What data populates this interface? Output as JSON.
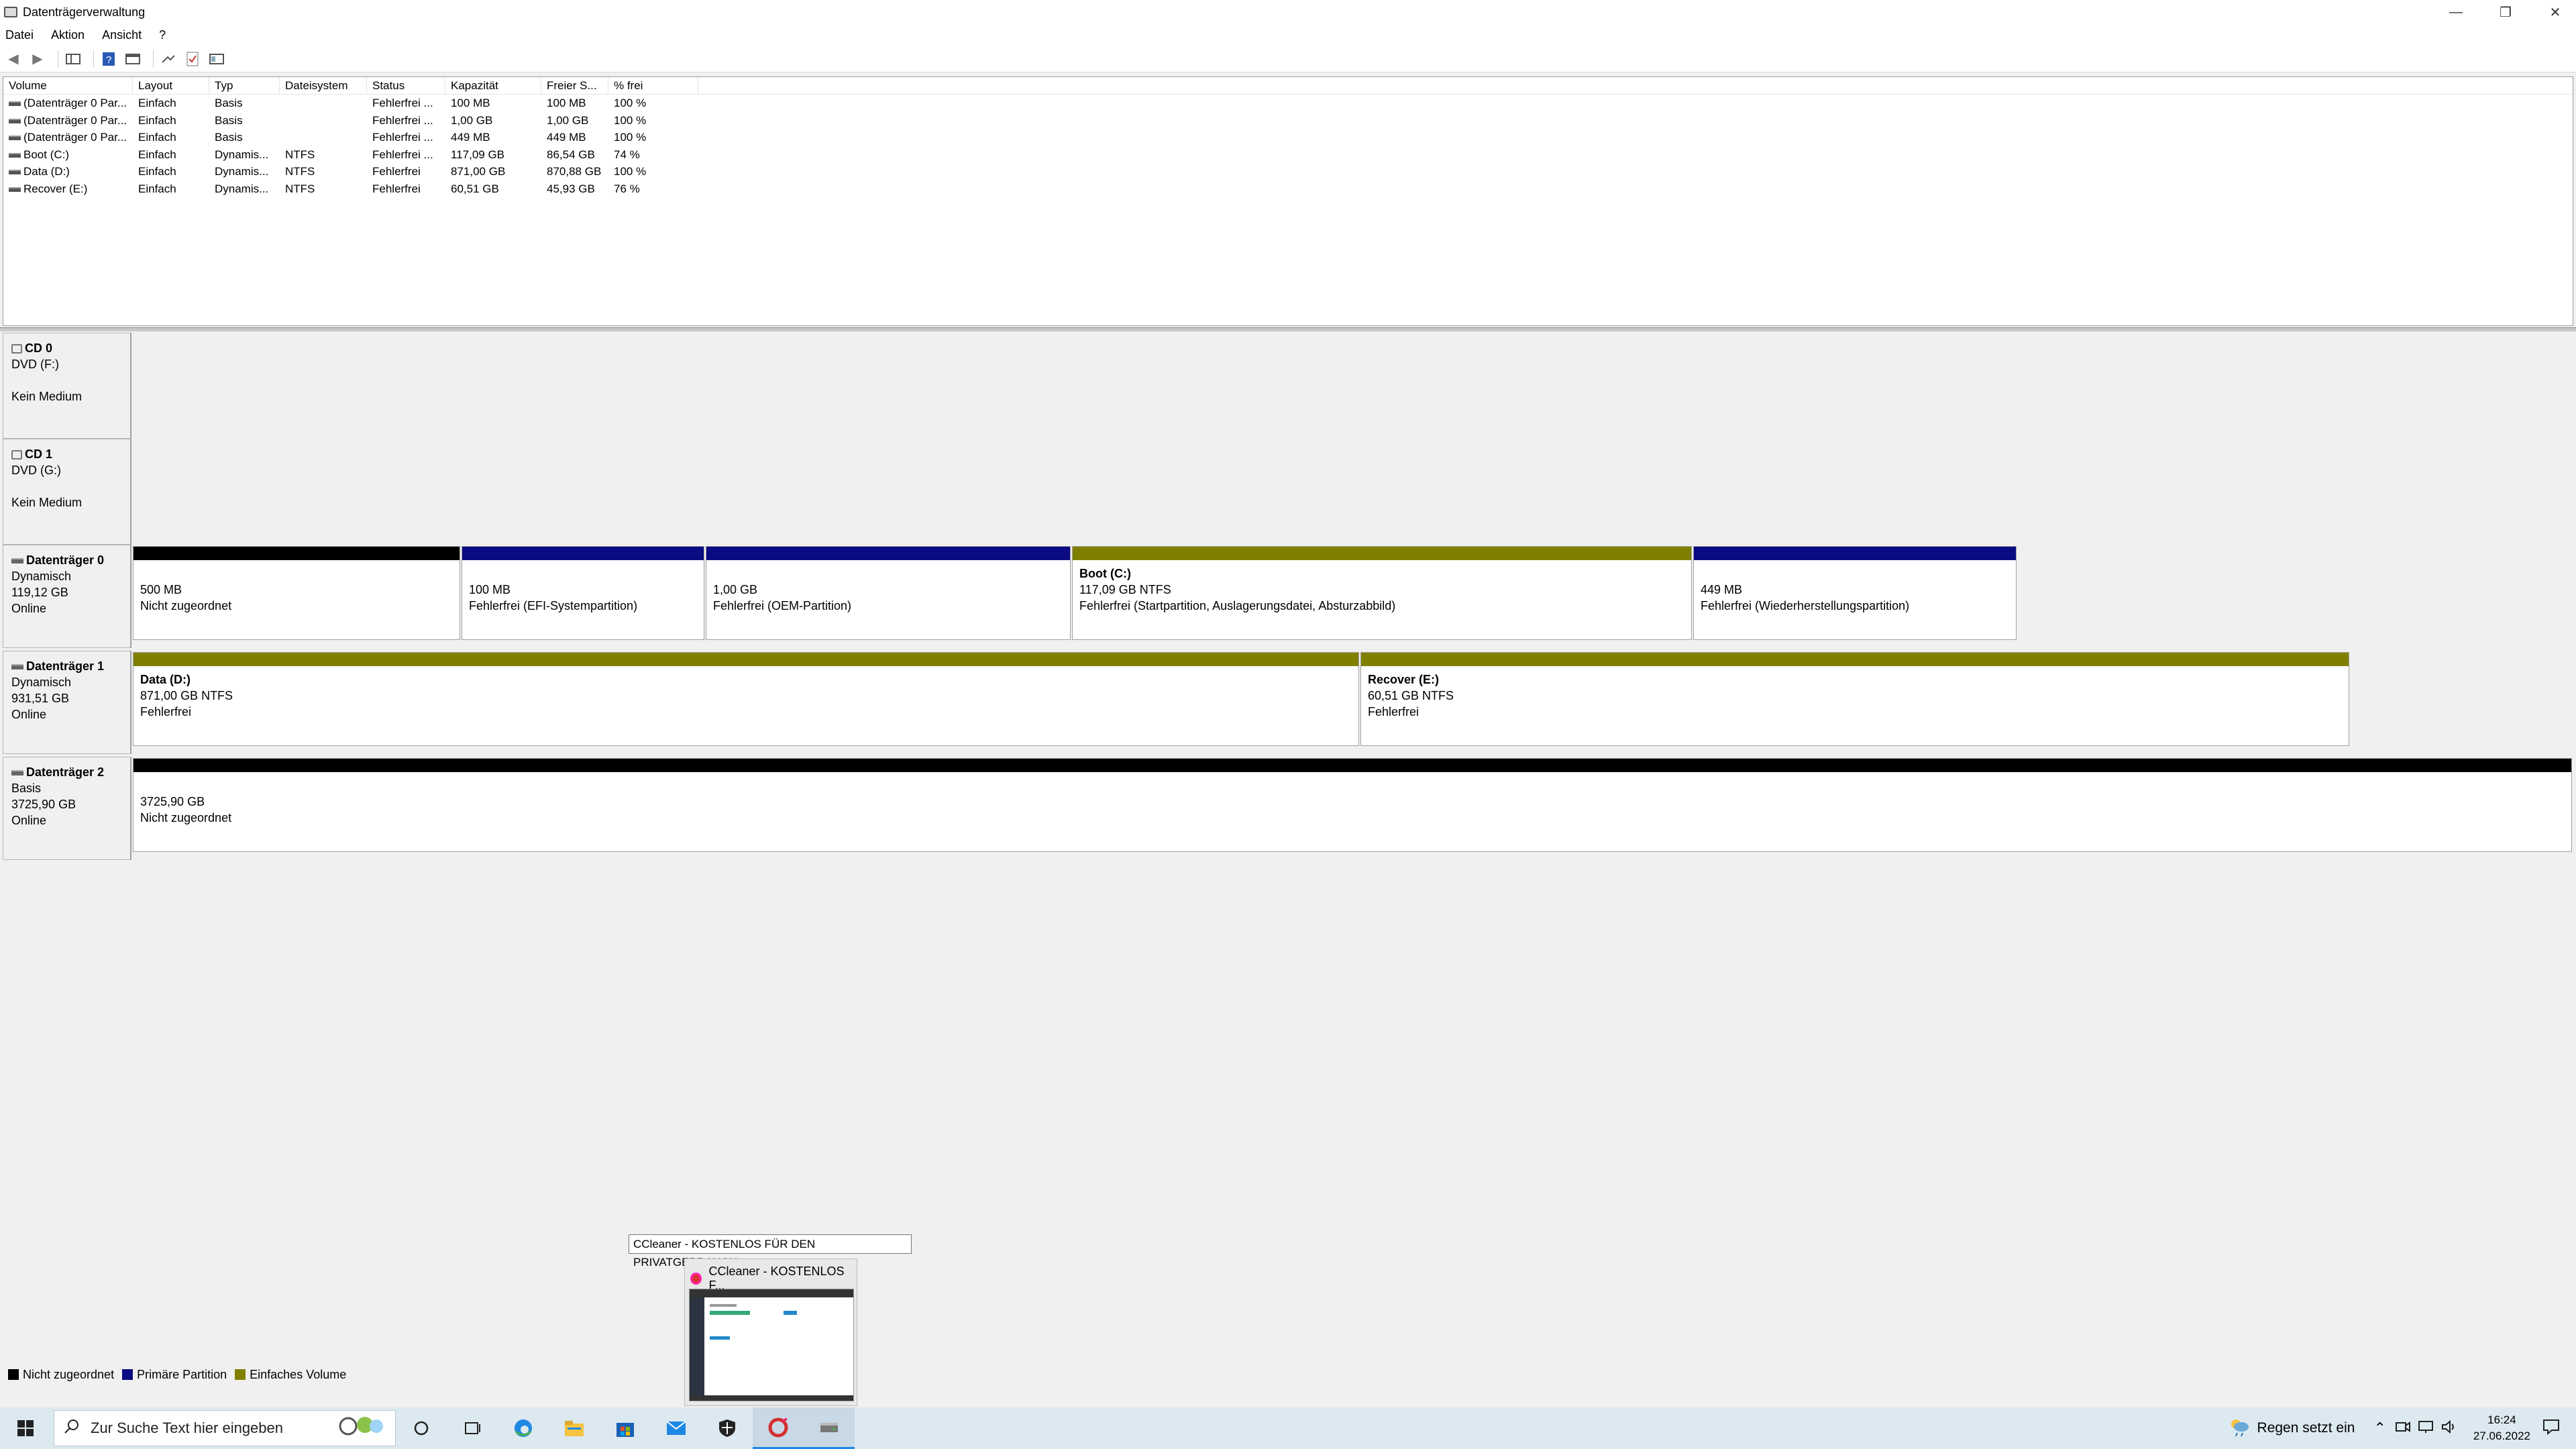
{
  "window": {
    "title": "Datenträgerverwaltung"
  },
  "menu": [
    "Datei",
    "Aktion",
    "Ansicht",
    "?"
  ],
  "volumes": {
    "columns": [
      "Volume",
      "Layout",
      "Typ",
      "Dateisystem",
      "Status",
      "Kapazität",
      "Freier S...",
      "% frei"
    ],
    "rows": [
      [
        "(Datenträger 0 Par...",
        "Einfach",
        "Basis",
        "",
        "Fehlerfrei ...",
        "100 MB",
        "100 MB",
        "100 %"
      ],
      [
        "(Datenträger 0 Par...",
        "Einfach",
        "Basis",
        "",
        "Fehlerfrei ...",
        "1,00 GB",
        "1,00 GB",
        "100 %"
      ],
      [
        "(Datenträger 0 Par...",
        "Einfach",
        "Basis",
        "",
        "Fehlerfrei ...",
        "449 MB",
        "449 MB",
        "100 %"
      ],
      [
        "Boot (C:)",
        "Einfach",
        "Dynamis...",
        "NTFS",
        "Fehlerfrei ...",
        "117,09 GB",
        "86,54 GB",
        "74 %"
      ],
      [
        "Data (D:)",
        "Einfach",
        "Dynamis...",
        "NTFS",
        "Fehlerfrei",
        "871,00 GB",
        "870,88 GB",
        "100 %"
      ],
      [
        "Recover (E:)",
        "Einfach",
        "Dynamis...",
        "NTFS",
        "Fehlerfrei",
        "60,51 GB",
        "45,93 GB",
        "76 %"
      ]
    ]
  },
  "disks": {
    "cd0": {
      "name": "CD 0",
      "line1": "DVD (F:)",
      "line3": "Kein Medium"
    },
    "cd1": {
      "name": "CD 1",
      "line1": "DVD (G:)",
      "line3": "Kein Medium"
    },
    "d0": {
      "name": "Datenträger 0",
      "type": "Dynamisch",
      "size": "119,12 GB",
      "state": "Online",
      "parts": [
        {
          "title": "",
          "size": "500 MB",
          "status": "Nicht zugeordnet"
        },
        {
          "title": "",
          "size": "100 MB",
          "status": "Fehlerfrei (EFI-Systempartition)"
        },
        {
          "title": "",
          "size": "1,00 GB",
          "status": "Fehlerfrei (OEM-Partition)"
        },
        {
          "title": "Boot  (C:)",
          "size": "117,09 GB NTFS",
          "status": "Fehlerfrei (Startpartition, Auslagerungsdatei, Absturzabbild)"
        },
        {
          "title": "",
          "size": "449 MB",
          "status": "Fehlerfrei (Wiederherstellungspartition)"
        }
      ]
    },
    "d1": {
      "name": "Datenträger 1",
      "type": "Dynamisch",
      "size": "931,51 GB",
      "state": "Online",
      "parts": [
        {
          "title": "Data  (D:)",
          "size": "871,00 GB NTFS",
          "status": "Fehlerfrei"
        },
        {
          "title": "Recover  (E:)",
          "size": "60,51 GB NTFS",
          "status": "Fehlerfrei"
        }
      ]
    },
    "d2": {
      "name": "Datenträger 2",
      "type": "Basis",
      "size": "3725,90 GB",
      "state": "Online",
      "parts": [
        {
          "title": "",
          "size": "3725,90 GB",
          "status": "Nicht zugeordnet"
        }
      ]
    }
  },
  "legend": [
    "Nicht zugeordnet",
    "Primäre Partition",
    "Einfaches Volume"
  ],
  "colors": {
    "unallocated": "#000000",
    "primary": "#0a0a82",
    "simple": "#808000"
  },
  "tooltip": "CCleaner - KOSTENLOS FÜR DEN PRIVATGEBRAUCH",
  "thumbnail": {
    "title": "CCleaner - KOSTENLOS F..."
  },
  "taskbar": {
    "search_placeholder": "Zur Suche Text hier eingeben",
    "weather": "Regen setzt ein",
    "time": "16:24",
    "date": "27.06.2022"
  }
}
